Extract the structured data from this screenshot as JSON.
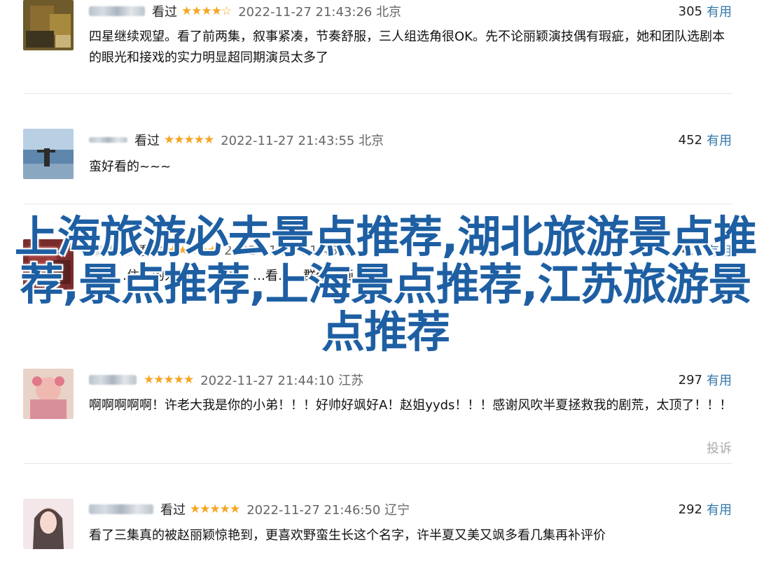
{
  "overlay": {
    "title": "上海旅游必去景点推荐,湖北旅游景点推荐,景点推荐,上海景点推荐,江苏旅游景点推荐",
    "color": "#1e5fa3"
  },
  "accent": {
    "star": "#f5a623",
    "link": "#3377aa"
  },
  "comments": [
    {
      "status": "看过",
      "stars": "★★★★☆",
      "time": "2022-11-27 21:43:26 北京",
      "votes": "305",
      "useful": "有用",
      "text": "四星继续观望。看了前两集，叙事紧凑，节奏舒服，三人组选角很OK。先不论丽颖演技偶有瑕疵，她和团队选剧本的眼光和接戏的实力明显超同期演员太多了",
      "avatar_icon": "user-avatar-icon"
    },
    {
      "status": "看过",
      "stars": "★★★★★",
      "time": "2022-11-27 21:43:55 北京",
      "votes": "452",
      "useful": "有用",
      "text": "蛮好看的~~~",
      "avatar_icon": "user-avatar-icon"
    },
    {
      "status": "看过",
      "stars": "★★★★★",
      "time": "2022-11-27 21:43:…",
      "votes": "4…",
      "useful": "有用",
      "text": "…集…住…的人物，…半夏，…看…，群像刻画…",
      "avatar_icon": "user-avatar-icon"
    },
    {
      "status": "",
      "stars": "★★★★★",
      "time": "2022-11-27 21:44:10 江苏",
      "votes": "297",
      "useful": "有用",
      "text": "啊啊啊啊啊！许老大我是你的小弟！！！好帅好飒好A！赵姐yyds！！！感谢风吹半夏拯救我的剧荒，太顶了！！！",
      "report": "投诉",
      "avatar_icon": "user-avatar-icon"
    },
    {
      "status": "看过",
      "stars": "★★★★★",
      "time": "2022-11-27 21:46:50 辽宁",
      "votes": "292",
      "useful": "有用",
      "text": "看了三集真的被赵丽颖惊艳到，更喜欢野蛮生长这个名字，许半夏又美又飒多看几集再补评价",
      "avatar_icon": "user-avatar-icon"
    }
  ]
}
